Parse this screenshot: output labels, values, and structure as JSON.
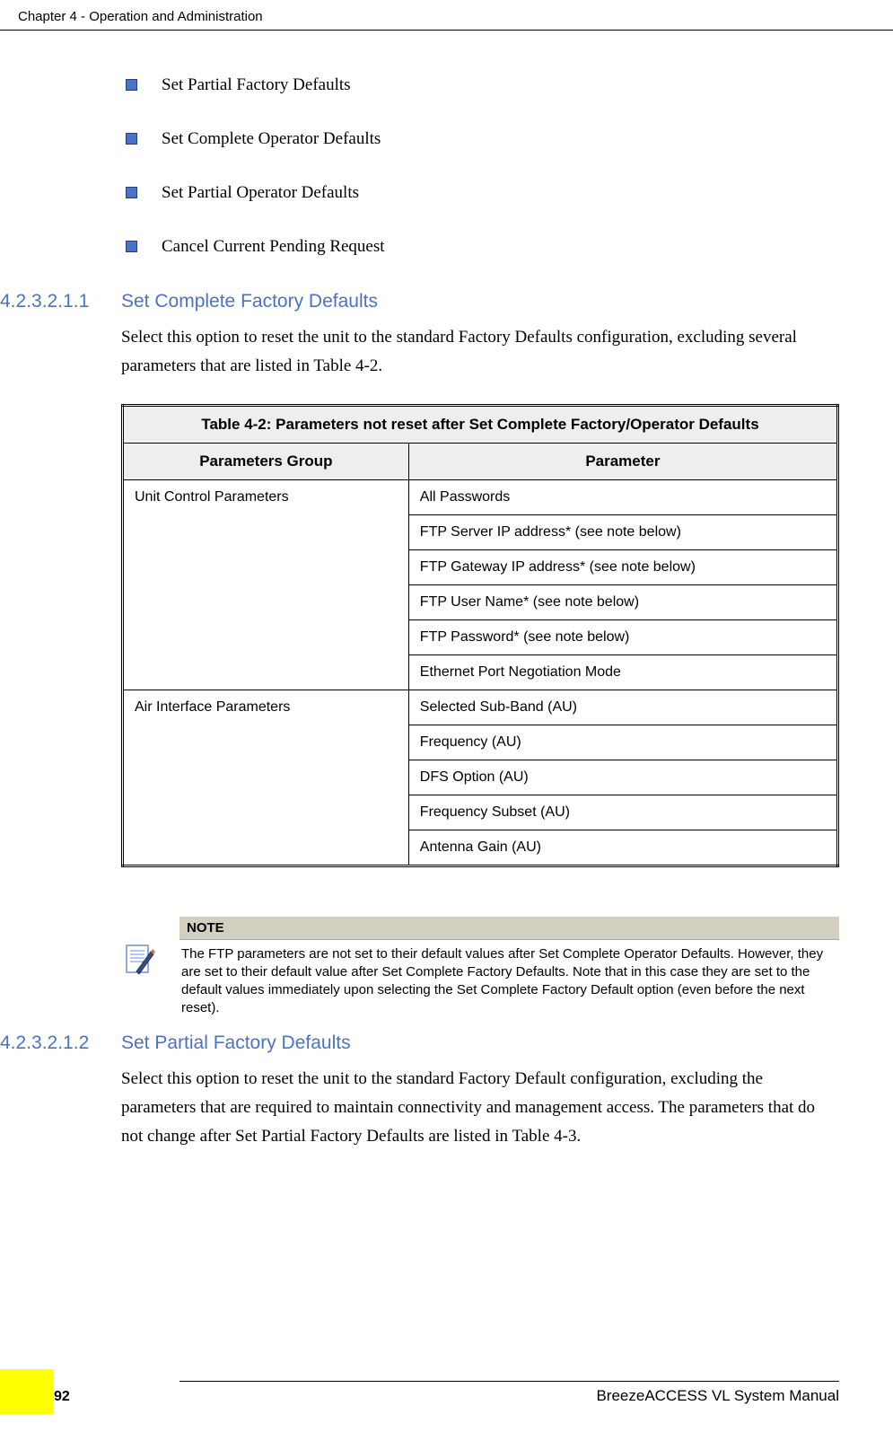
{
  "header": {
    "chapter_title": "Chapter 4 - Operation and Administration"
  },
  "bullets": {
    "item1": "Set Partial Factory Defaults",
    "item2": "Set Complete Operator Defaults",
    "item3": "Set Partial Operator Defaults",
    "item4": "Cancel Current Pending Request"
  },
  "section1": {
    "number": "4.2.3.2.1.1",
    "title": "Set Complete Factory Defaults",
    "body": "Select this option to reset the unit to the standard Factory Defaults configuration, excluding several parameters that are listed in Table 4-2."
  },
  "table": {
    "caption": "Table 4-2: Parameters not reset after Set Complete Factory/Operator Defaults",
    "col1": "Parameters Group",
    "col2": "Parameter",
    "group1": "Unit Control Parameters",
    "g1r1": "All Passwords",
    "g1r2": "FTP Server IP address* (see note below)",
    "g1r3": "FTP Gateway IP address* (see note below)",
    "g1r4": "FTP User Name* (see note below)",
    "g1r5": "FTP Password* (see note below)",
    "g1r6": "Ethernet Port Negotiation Mode",
    "group2": "Air Interface Parameters",
    "g2r1": "Selected Sub-Band (AU)",
    "g2r2": "Frequency (AU)",
    "g2r3": "DFS Option (AU)",
    "g2r4": "Frequency Subset (AU)",
    "g2r5": "Antenna Gain (AU)"
  },
  "note": {
    "header": "NOTE",
    "body": "The FTP parameters are not set to their default values after Set Complete Operator Defaults. However, they are set to their default value after Set Complete Factory Defaults. Note that in this case they are set to the default values immediately upon selecting the Set Complete Factory Default option (even before the next reset)."
  },
  "section2": {
    "number": "4.2.3.2.1.2",
    "title": "Set Partial Factory Defaults",
    "body": "Select this option to reset the unit to the standard Factory Default configuration, excluding the parameters that are required to maintain connectivity and management access. The parameters that do not change after Set Partial Factory Defaults are listed in Table 4-3."
  },
  "footer": {
    "page": "92",
    "manual": "BreezeACCESS VL System Manual"
  }
}
